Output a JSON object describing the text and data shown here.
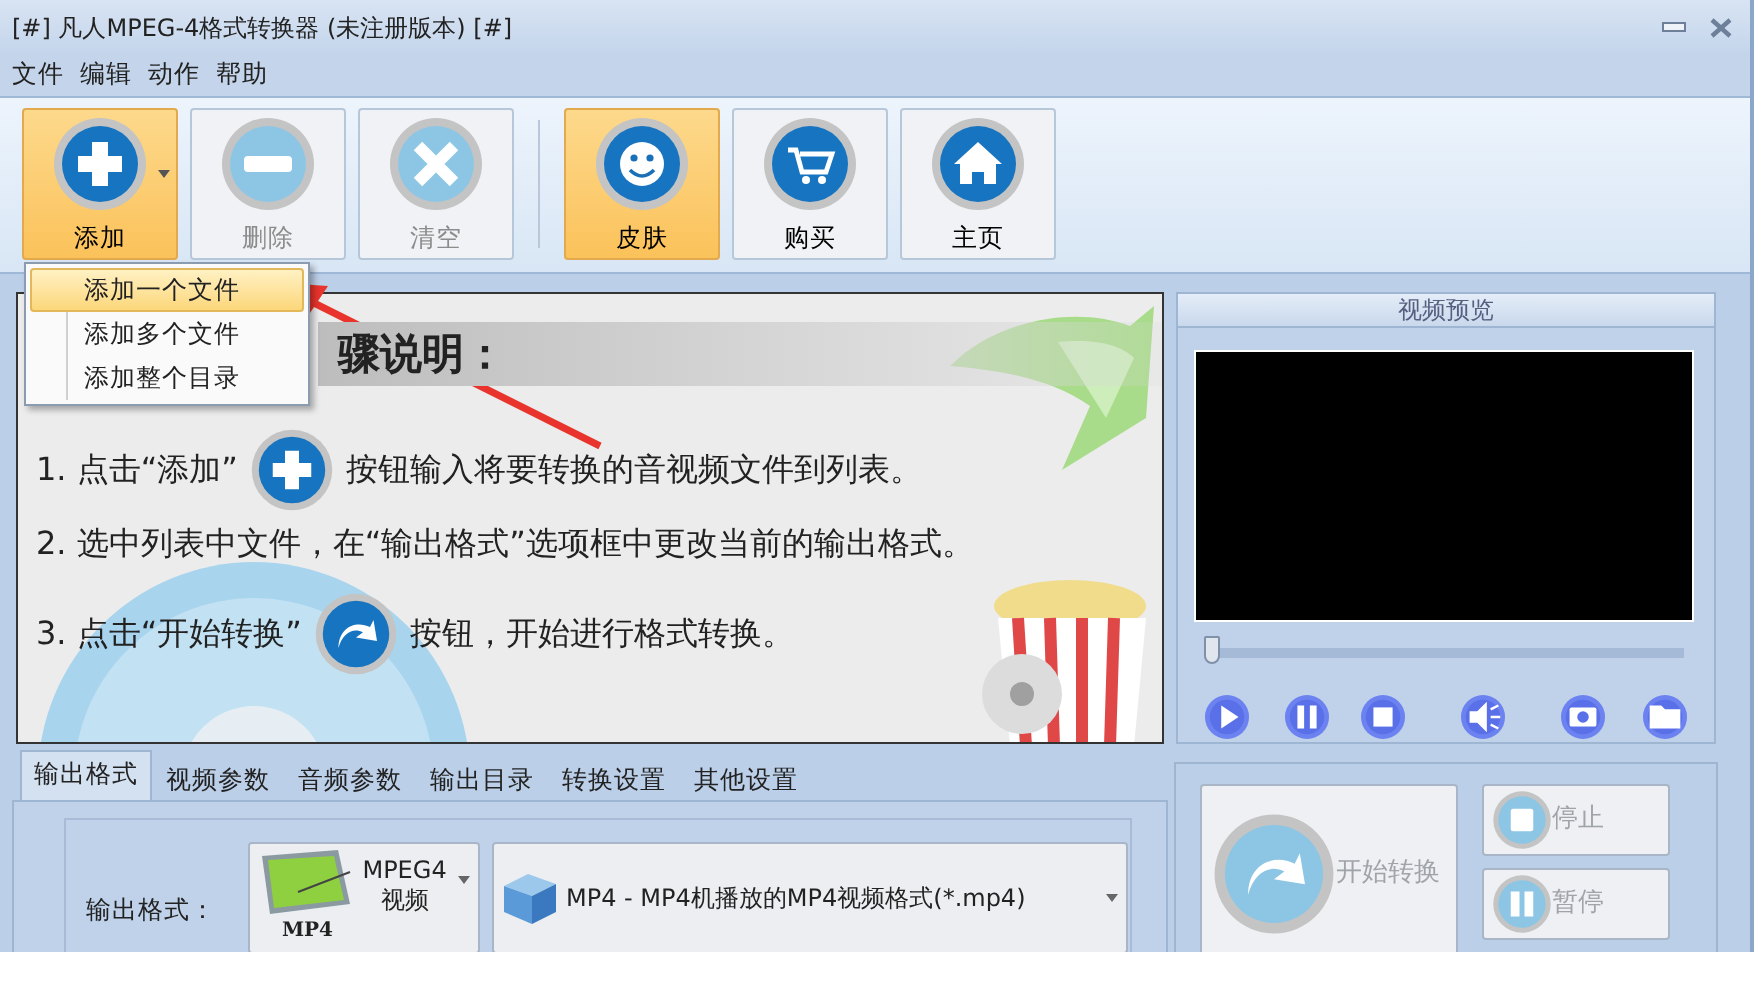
{
  "window": {
    "title": "[#] 凡人MPEG-4格式转换器  (未注册版本) [#]"
  },
  "menu": [
    "文件",
    "编辑",
    "动作",
    "帮助"
  ],
  "toolbar": [
    {
      "kind": "button",
      "label": "添加",
      "highlighted": true,
      "disabled": false,
      "dropdown": true
    },
    {
      "kind": "button",
      "label": "删除",
      "highlighted": false,
      "disabled": true,
      "dropdown": false
    },
    {
      "kind": "button",
      "label": "清空",
      "highlighted": false,
      "disabled": true,
      "dropdown": false
    },
    {
      "kind": "separator"
    },
    {
      "kind": "button",
      "label": "皮肤",
      "highlighted": true,
      "disabled": false,
      "dropdown": false
    },
    {
      "kind": "button",
      "label": "购买",
      "highlighted": false,
      "disabled": false,
      "dropdown": false
    },
    {
      "kind": "button",
      "label": "主页",
      "highlighted": false,
      "disabled": false,
      "dropdown": false
    }
  ],
  "add_menu": [
    {
      "label": "添加一个文件",
      "selected": true
    },
    {
      "label": "添加多个文件",
      "selected": false
    },
    {
      "label": "添加整个目录",
      "selected": false
    }
  ],
  "guide": {
    "heading": "骤说明：",
    "steps": [
      {
        "kind": "with_icon",
        "before": "1. 点击“添加”",
        "after": "按钮输入将要转换的音视频文件到列表。"
      },
      {
        "kind": "text",
        "before": "2. 选中列表中文件，在“输出格式”选项框中更改当前的输出格式。"
      },
      {
        "kind": "with_icon",
        "before": "3. 点击“开始转换”",
        "after": "按钮，开始进行格式转换。"
      }
    ]
  },
  "preview": {
    "title": "视频预览",
    "seek": {
      "level": 0
    }
  },
  "tabs": [
    {
      "label": "输出格式",
      "selected": true
    },
    {
      "label": "视频参数",
      "selected": false
    },
    {
      "label": "音频参数",
      "selected": false
    },
    {
      "label": "输出目录",
      "selected": false
    },
    {
      "label": "转换设置",
      "selected": false
    },
    {
      "label": "其他设置",
      "selected": false
    }
  ],
  "output": {
    "label": "输出格式：",
    "category": "MPEG4视频",
    "category_badge": "MP4",
    "format": "MP4 - MP4机播放的MP4视频格式(*.mp4)"
  },
  "actions": {
    "start": {
      "label": "开始转换",
      "disabled": true
    },
    "stop": {
      "label": "停止",
      "disabled": true
    },
    "pause": {
      "label": "暂停",
      "disabled": true
    }
  }
}
